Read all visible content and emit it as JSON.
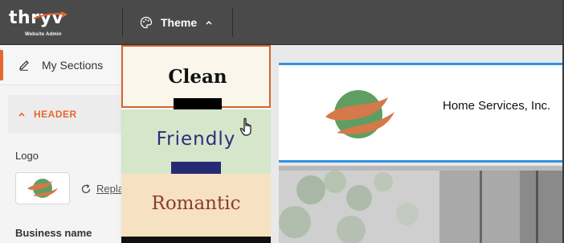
{
  "topbar": {
    "logo_word": "thryv",
    "logo_sub": "Website Admin",
    "theme_label": "Theme",
    "theme_icon": "palette-icon",
    "chevron_icon": "chevron-up-icon"
  },
  "sidebar": {
    "sections_label": "My Sections",
    "sections_icon": "pencil-icon",
    "header_section_label": "HEADER",
    "logo_label": "Logo",
    "replace_label": "Repla",
    "business_name_label": "Business name"
  },
  "theme_dropdown": {
    "options": [
      {
        "label": "Clean",
        "selected": true
      },
      {
        "label": "Friendly",
        "selected": false,
        "hovered": true
      },
      {
        "label": "Romantic",
        "selected": false
      }
    ]
  },
  "preview": {
    "business_name": "Home Services, Inc."
  },
  "colors": {
    "accent": "#e8672f",
    "topbar": "#4a4a4a",
    "preview_border": "#3193e3",
    "clean_bg": "#faf6ec",
    "friendly_bg": "#d5e6cb",
    "friendly_text": "#2a2e7a",
    "romantic_bg": "#f6e2c0",
    "romantic_text": "#8b3b33",
    "logo_green": "#5f9e62",
    "logo_orange": "#d5784a"
  }
}
